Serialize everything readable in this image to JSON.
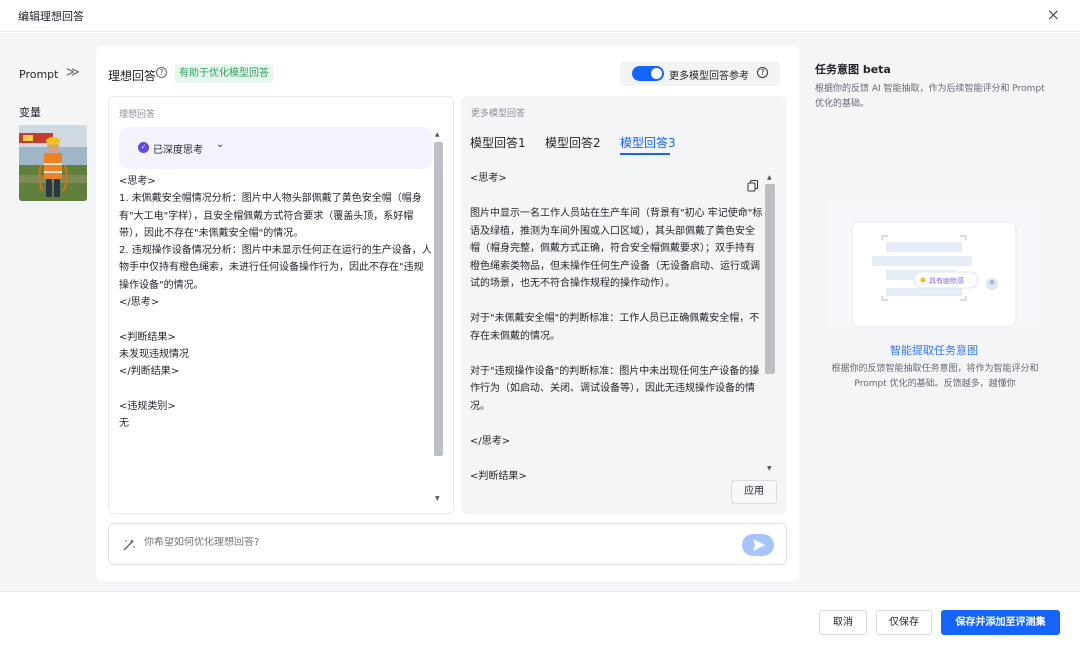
{
  "dialog": {
    "title": "编辑理想回答",
    "close_glyph": "×"
  },
  "nav": {
    "prompt_label": "Prompt",
    "collapse_glyph": "≫",
    "variable_label": "变量"
  },
  "header": {
    "ideal_label": "理想回答",
    "help_glyph": "?",
    "green_tag": "有助于优化模型回答",
    "toggle_label": "更多模型回答参考",
    "toggle_on": true
  },
  "left_panel": {
    "label": "理想回答",
    "think_label": "已深度思考",
    "think_check": "✓",
    "caret": "⌄",
    "content": "<思考>\n1. 未佩戴安全帽情况分析：图片中人物头部佩戴了黄色安全帽（帽身有\"大工电\"字样），且安全帽佩戴方式符合要求（覆盖头顶，系好帽带），因此不存在\"未佩戴安全帽\"的情况。\n2. 违规操作设备情况分析：图片中未显示任何正在运行的生产设备，人物手中仅持有橙色绳索，未进行任何设备操作行为，因此不存在\"违规操作设备\"的情况。\n</思考>\n\n<判断结果>\n未发现违规情况\n</判断结果>\n\n<违规类别>\n无"
  },
  "right_panel": {
    "label": "更多模型回答",
    "tabs": [
      "模型回答1",
      "模型回答2",
      "模型回答3"
    ],
    "active_tab": 2,
    "content": "<思考>\n\n图片中显示一名工作人员站在生产车间（背景有\"初心 牢记使命\"标语及绿植，推测为车间外围或入口区域），其头部佩戴了黄色安全帽（帽身完整，佩戴方式正确，符合安全帽佩戴要求）；双手持有橙色绳索类物品，但未操作任何生产设备（无设备启动、运行或调试的场景，也无不符合操作规程的操作动作）。\n\n对于\"未佩戴安全帽\"的判断标准：工作人员已正确佩戴安全帽，不存在未佩戴的情况。\n\n对于\"违规操作设备\"的判断标准：图片中未出现任何生产设备的操作行为（如启动、关闭、调试设备等），因此无违规操作设备的情况。\n\n</思考>\n\n<判断结果>",
    "apply_label": "应用"
  },
  "input": {
    "placeholder": "你希望如何优化理想回答?"
  },
  "side": {
    "title": "任务意图 beta",
    "desc": "根据你的反馈 AI 智能抽取，作为后续智能评分和 Prompt 优化的基础。",
    "illus_badge": "具有幽默感",
    "link": "智能提取任务意图",
    "desc2": "根据你的反馈智能抽取任务意图，将作为智能评分和 Prompt 优化的基础。反馈越多，越懂你"
  },
  "footer": {
    "cancel": "取消",
    "save_only": "仅保存",
    "save_add": "保存并添加至评测集"
  },
  "colors": {
    "accent": "#1664ff",
    "green": "#2ea15c",
    "purple": "#6447e8"
  }
}
